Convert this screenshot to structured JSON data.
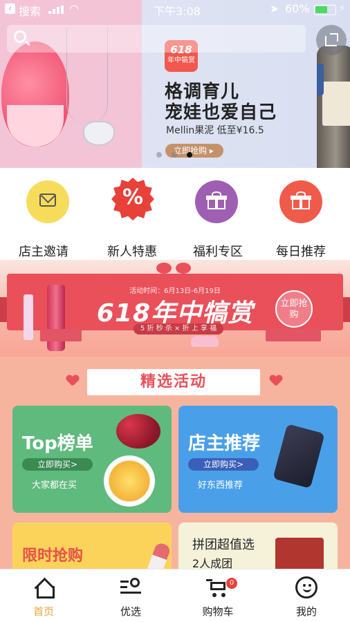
{
  "status_bar": {
    "back_app": "搜索",
    "time": "下午3:08",
    "battery": "60%",
    "battery_level": 0.6
  },
  "hero": {
    "badge_top": "618",
    "badge_bottom": "年中犒赏",
    "title_line1": "格调育儿",
    "title_line2": "宠娃也爱自己",
    "subtitle": "Mellin果泥 低至¥16.5",
    "button": "立即抢购 ▸",
    "slides": 3,
    "active_slide": 2
  },
  "categories": [
    {
      "label": "店主邀请",
      "icon": "envelope-icon",
      "color": "#f7dc5c"
    },
    {
      "label": "新人特惠",
      "icon": "percent-icon",
      "color": "#e8413a"
    },
    {
      "label": "福利专区",
      "icon": "gift-icon",
      "color": "#9e5fb3"
    },
    {
      "label": "每日推荐",
      "icon": "gift-icon",
      "color": "#f05a4a"
    }
  ],
  "promo": {
    "date": "活动时间：6月13日-6月19日",
    "title": "618年中犒赏",
    "subtitle": "5 折 秒 杀 × 折 上 享 福",
    "button": "立即抢购"
  },
  "section": {
    "title": "精选活动"
  },
  "cards": [
    {
      "title": "Top榜单",
      "button": "立即购买>",
      "subtitle": "大家都在买",
      "color": "#5fba7d",
      "btn_color": "#3a8a52"
    },
    {
      "title": "店主推荐",
      "button": "立即购买>",
      "subtitle": "好东西推荐",
      "color": "#4aa0e8",
      "btn_color": "#3b5fb8"
    },
    {
      "title": "限时抢购",
      "color": "#fbd35a"
    },
    {
      "title": "拼团超值选",
      "subtitle": "2人成团",
      "color": "#f6f2da"
    }
  ],
  "tabbar": {
    "tabs": [
      {
        "label": "首页",
        "icon": "home-icon",
        "active": true
      },
      {
        "label": "优选",
        "icon": "search-list-icon"
      },
      {
        "label": "购物车",
        "icon": "cart-icon",
        "badge": "0"
      },
      {
        "label": "我的",
        "icon": "smile-icon"
      }
    ]
  }
}
